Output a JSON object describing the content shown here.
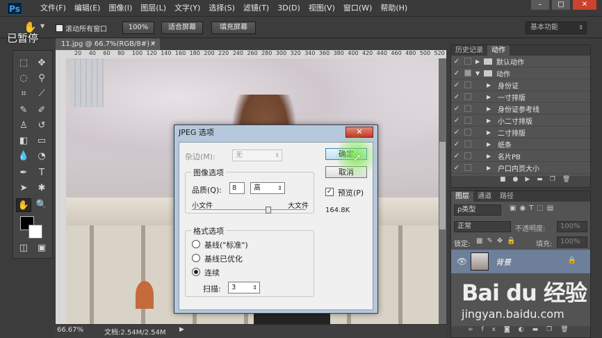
{
  "app": {
    "logo": "Ps"
  },
  "menu": [
    "文件(F)",
    "编辑(E)",
    "图像(I)",
    "图层(L)",
    "文字(Y)",
    "选择(S)",
    "滤镜(T)",
    "3D(D)",
    "视图(V)",
    "窗口(W)",
    "帮助(H)"
  ],
  "window_controls": {
    "minimize": "–",
    "maximize": "□",
    "close": "✕"
  },
  "optbar": {
    "scroll_all": "滚动所有窗口",
    "zoom_100": "100%",
    "fit_screen": "适合屏幕",
    "fill_screen": "填充屏幕",
    "workspace": "基本功能"
  },
  "overlay": {
    "paused": "已暂停"
  },
  "document": {
    "tab_title": "11.jpg @ 66.7%(RGB/8#) *",
    "tab_close": "×",
    "ruler_marks": [
      "20",
      "40",
      "60",
      "80",
      "100",
      "120",
      "140",
      "160",
      "180",
      "200",
      "220",
      "240",
      "260",
      "280",
      "300",
      "320",
      "340",
      "360",
      "380",
      "400",
      "420",
      "440",
      "460",
      "480",
      "500",
      "520"
    ],
    "zoom": "66.67%",
    "doc_info": "文档:2.54M/2.54M"
  },
  "dialog": {
    "title": "JPEG 选项",
    "close": "✕",
    "matte_label": "杂边(M):",
    "matte_value": "无",
    "image_options": "图像选项",
    "quality_label": "品质(Q):",
    "quality_value": "8",
    "quality_preset": "高",
    "small_file": "小文件",
    "large_file": "大文件",
    "quality_slider_fraction": 0.67,
    "format_options": "格式选项",
    "format_radios": [
      "基线(\"标准\")",
      "基线已优化",
      "连续"
    ],
    "selected_format": 2,
    "scans_label": "扫描:",
    "scans_value": "3",
    "ok": "确定",
    "cancel": "取消",
    "preview": "预览(P)",
    "preview_checked": true,
    "file_size": "164.8K"
  },
  "history_panel": {
    "tabs": [
      "历史记录",
      "动作"
    ],
    "active_tab": 1,
    "actions": [
      {
        "label": "默认动作",
        "type": "set",
        "expanded": false
      },
      {
        "label": "动作",
        "type": "set",
        "expanded": true
      },
      {
        "label": "身份证",
        "type": "action"
      },
      {
        "label": "一寸排版",
        "type": "action"
      },
      {
        "label": "身份证参考线",
        "type": "action"
      },
      {
        "label": "小二寸排版",
        "type": "action"
      },
      {
        "label": "二寸排版",
        "type": "action"
      },
      {
        "label": "纸条",
        "type": "action"
      },
      {
        "label": "名片PB",
        "type": "action"
      },
      {
        "label": "户口内页大小",
        "type": "action"
      }
    ]
  },
  "layers_panel": {
    "tabs": [
      "图层",
      "通道",
      "路径"
    ],
    "active_tab": 0,
    "filter_kind": "ρ类型",
    "blend_mode": "正常",
    "opacity_label": "不透明度:",
    "opacity_value": "100%",
    "lock_label": "锁定:",
    "fill_label": "填充:",
    "fill_value": "100%",
    "layer_name": "背景"
  },
  "watermark": {
    "brand": "Bai du 经验",
    "url": "jingyan.baidu.com"
  },
  "colors": {
    "accent": "#39a3ff",
    "dialog_frame": "#b5c8dc",
    "layer_selected": "#6d7f99",
    "close_red": "#c23b22"
  }
}
